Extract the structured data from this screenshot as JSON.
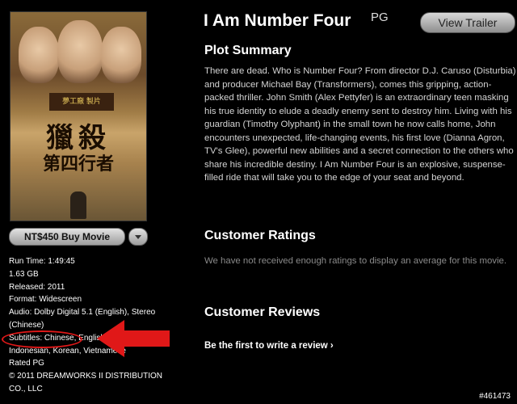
{
  "movie": {
    "title": "I Am Number Four",
    "rating_badge": "PG",
    "poster": {
      "studio_badge": "夢工廠 製片",
      "title_line1": "獵殺",
      "title_line2": "第四行者"
    }
  },
  "buttons": {
    "view_trailer": "View Trailer",
    "buy": "NT$450 Buy Movie"
  },
  "details": {
    "run_time": "Run Time: 1:49:45",
    "size": "1.63 GB",
    "released": "Released: 2011",
    "format": "Format: Widescreen",
    "audio": "Audio: Dolby Digital 5.1 (English), Stereo (Chinese)",
    "subtitles": "Subtitles: Chinese, English,",
    "subtitles_cont": "Indonesian, Korean, Vietnamese",
    "rated": "Rated PG",
    "copyright": "© 2011 DREAMWORKS II DISTRIBUTION CO., LLC"
  },
  "plot": {
    "heading": "Plot Summary",
    "text": "There are dead. Who is Number Four? From director D.J. Caruso (Disturbia) and producer Michael Bay (Transformers), comes this gripping, action-packed thriller. John Smith (Alex Pettyfer) is an extraordinary teen masking his true identity to elude a deadly enemy sent to destroy him. Living with his guardian (Timothy Olyphant) in the small town he now calls home, John encounters unexpected, life-changing events, his first love (Dianna Agron, TV's Glee), powerful new abilities and a secret connection to the others who share his incredible destiny. I Am Number Four is an explosive, suspense-filled ride that will take you to the edge of your seat and beyond."
  },
  "ratings": {
    "heading": "Customer Ratings",
    "text": "We have not received enough ratings to display an average for this movie."
  },
  "reviews": {
    "heading": "Customer Reviews",
    "link": "Be the first to write a review ›"
  },
  "watermark": "#461473",
  "colors": {
    "background": "#000000",
    "annotation_red": "#e01818",
    "button_gray": "#c8c8c8",
    "secondary_text": "#8a8a8a"
  }
}
